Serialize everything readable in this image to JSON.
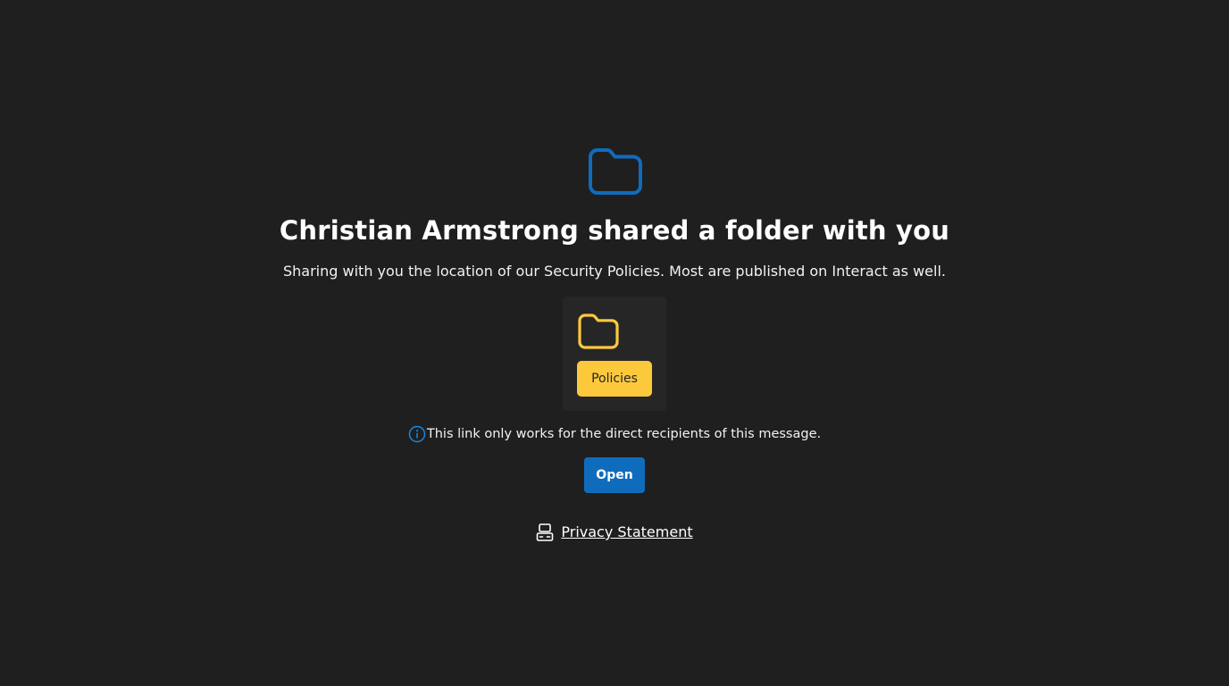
{
  "header": {
    "icon": "folder-icon",
    "title": "Christian Armstrong shared a folder with you"
  },
  "message": "Sharing with you the location of our Security Policies. Most are published on Interact as well.",
  "shared_item": {
    "icon": "folder-icon",
    "name": "Policies"
  },
  "notice": {
    "icon": "info-icon",
    "text": "This link only works for the direct recipients of this message."
  },
  "actions": {
    "open_label": "Open"
  },
  "footer": {
    "icon": "privacy-icon",
    "privacy_label": "Privacy Statement"
  },
  "colors": {
    "background": "#1f1f1f",
    "accent_blue": "#0f6cbd",
    "folder_yellow": "#fcc93d"
  }
}
